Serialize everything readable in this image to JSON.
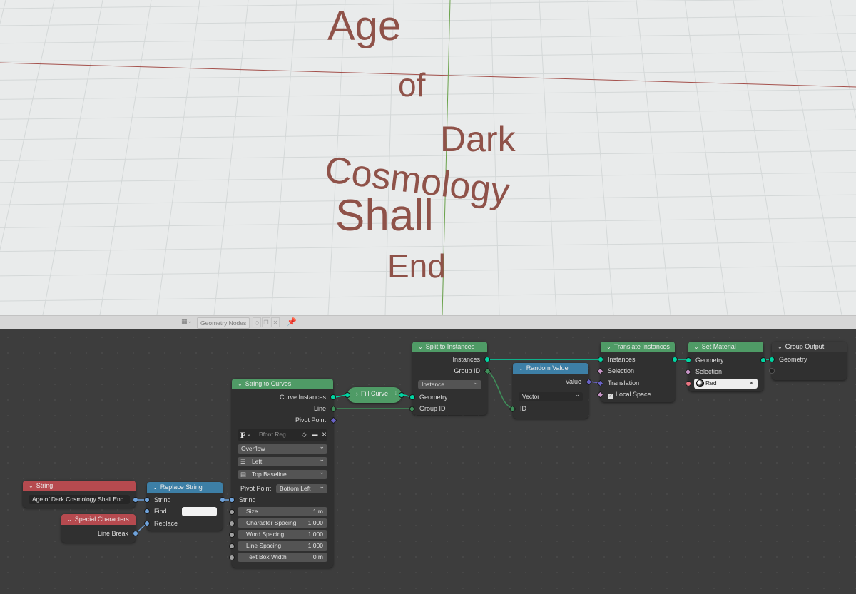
{
  "viewport": {
    "words": [
      "Age",
      "of",
      "Dark",
      "Cosmology",
      "Shall",
      "End"
    ],
    "text_color": "#8f5249",
    "grid_color": "#d4d8d8",
    "axis_x_color": "#a4504b",
    "axis_y_color": "#6aa24b"
  },
  "node_header_bar": {
    "tree_name": "Geometry Nodes",
    "editor_icon": "node-editor-icon",
    "pin_icon": "pin-icon"
  },
  "nodes": {
    "string": {
      "title": "String",
      "value": "Age of Dark Cosmology Shall End"
    },
    "special_characters": {
      "title": "Special Characters",
      "line_break": "Line Break"
    },
    "replace_string": {
      "title": "Replace String",
      "string": "String",
      "find": "Find",
      "replace": "Replace"
    },
    "string_to_curves": {
      "title": "String to Curves",
      "curve_instances": "Curve Instances",
      "line": "Line",
      "pivot_point_out": "Pivot Point",
      "font": "Bfont Reg...",
      "overflow": "Overflow",
      "align_x": "Left",
      "align_y": "Top Baseline",
      "pivot_point_label": "Pivot Point",
      "pivot_point_value": "Bottom Left",
      "string_in": "String",
      "size_label": "Size",
      "size_value": "1 m",
      "char_spacing_label": "Character Spacing",
      "char_spacing_value": "1.000",
      "word_spacing_label": "Word Spacing",
      "word_spacing_value": "1.000",
      "line_spacing_label": "Line Spacing",
      "line_spacing_value": "1.000",
      "text_box_width_label": "Text Box Width",
      "text_box_width_value": "0 m"
    },
    "fill_curve": {
      "title": "Fill Curve"
    },
    "split_to_instances": {
      "title": "Split to Instances",
      "instances": "Instances",
      "group_id_out": "Group ID",
      "domain": "Instance",
      "geometry": "Geometry",
      "group_id_in": "Group ID"
    },
    "random_value": {
      "title": "Random Value",
      "value": "Value",
      "type": "Vector",
      "id": "ID"
    },
    "translate_instances": {
      "title": "Translate Instances",
      "instances": "Instances",
      "selection": "Selection",
      "translation": "Translation",
      "local_space": "Local Space"
    },
    "set_material": {
      "title": "Set Material",
      "geometry": "Geometry",
      "selection": "Selection",
      "material": "Red"
    },
    "group_output": {
      "title": "Group Output",
      "geometry": "Geometry"
    }
  },
  "colors": {
    "geometry_node": "#4f9b66",
    "function_node": "#3d7fa6",
    "input_node": "#b64a4f",
    "output_node": "#3a3a3a",
    "geometry_socket": "#00d6a3",
    "string_socket": "#6fa3dc",
    "vector_socket": "#6a63c8"
  }
}
